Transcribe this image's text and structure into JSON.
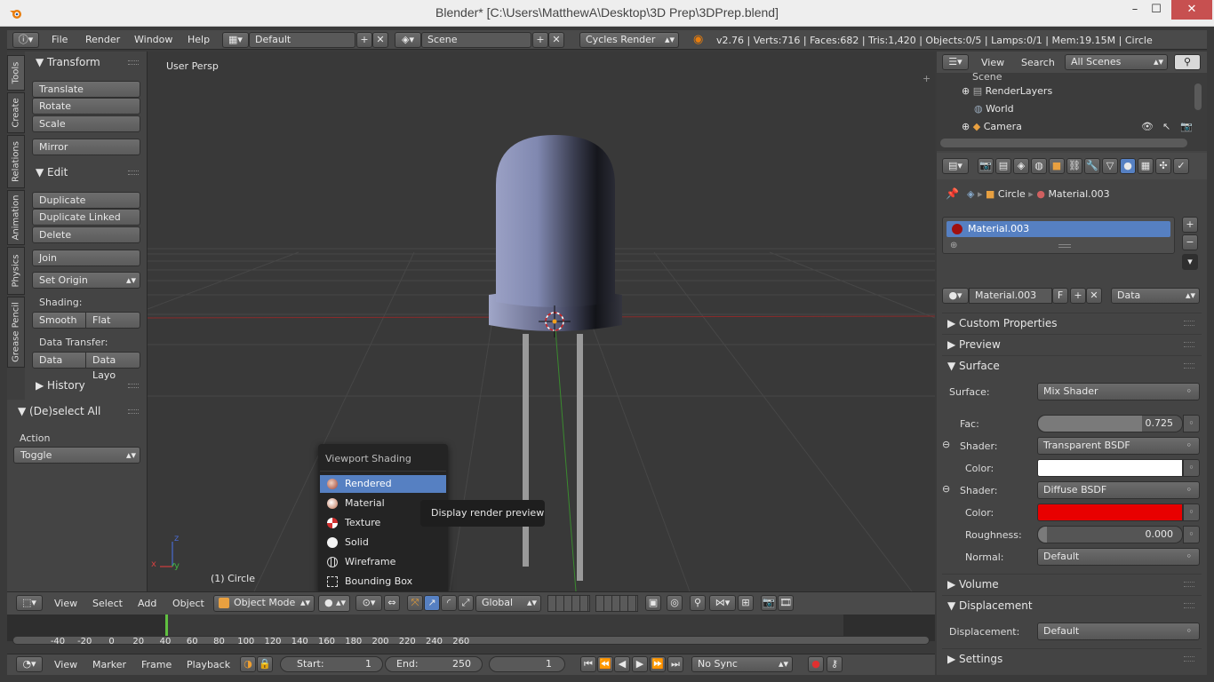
{
  "window": {
    "title": "Blender* [C:\\Users\\MatthewA\\Desktop\\3D Prep\\3DPrep.blend]",
    "minimize": "–",
    "maximize": "☐",
    "close": "✕"
  },
  "info_header": {
    "menus": [
      "File",
      "Render",
      "Window",
      "Help"
    ],
    "layout": "Default",
    "scene": "Scene",
    "engine": "Cycles Render",
    "stats": "v2.76 | Verts:716 | Faces:682 | Tris:1,420 | Objects:0/5 | Lamps:0/1 | Mem:19.15M | Circle"
  },
  "left_tabs": [
    "Tools",
    "Create",
    "Relations",
    "Animation",
    "Physics",
    "Grease Pencil"
  ],
  "tool_shelf": {
    "transform_title": "Transform",
    "translate": "Translate",
    "rotate": "Rotate",
    "scale": "Scale",
    "mirror": "Mirror",
    "edit_title": "Edit",
    "duplicate": "Duplicate",
    "duplicate_linked": "Duplicate Linked",
    "delete": "Delete",
    "join": "Join",
    "set_origin": "Set Origin",
    "shading_label": "Shading:",
    "smooth": "Smooth",
    "flat": "Flat",
    "data_transfer_label": "Data Transfer:",
    "data": "Data",
    "data_layout": "Data Layo",
    "history_title": "History"
  },
  "operator_panel": {
    "title": "(De)select All",
    "action_label": "Action",
    "action_value": "Toggle"
  },
  "viewport": {
    "view_label": "User Persp",
    "object_label": "(1) Circle",
    "axis_x": "x",
    "axis_y": "y",
    "axis_z": "z"
  },
  "shading_popup": {
    "title": "Viewport Shading",
    "items": [
      "Rendered",
      "Material",
      "Texture",
      "Solid",
      "Wireframe",
      "Bounding Box"
    ],
    "selected": "Rendered"
  },
  "tooltip": "Display render preview",
  "viewport_header": {
    "menus": [
      "View",
      "Select",
      "Add",
      "Object"
    ],
    "mode": "Object Mode",
    "orientation": "Global"
  },
  "timeline": {
    "ticks": [
      "-40",
      "-20",
      "0",
      "20",
      "40",
      "60",
      "80",
      "100",
      "120",
      "140",
      "160",
      "180",
      "200",
      "220",
      "240",
      "260"
    ],
    "current_frame_mark": 0
  },
  "timeline_header": {
    "menus": [
      "View",
      "Marker",
      "Frame",
      "Playback"
    ],
    "start_label": "Start:",
    "start_value": "1",
    "end_label": "End:",
    "end_value": "250",
    "current_frame": "1",
    "sync": "No Sync"
  },
  "outliner": {
    "menus": [
      "View",
      "Search"
    ],
    "filter": "All Scenes",
    "items": [
      "Scene",
      "RenderLayers",
      "World",
      "Camera"
    ]
  },
  "properties": {
    "breadcrumb_object": "Circle",
    "breadcrumb_material": "Material.003",
    "slot_name": "Material.003",
    "material_field": "Material.003",
    "fake_user": "F",
    "link": "Data",
    "sections": {
      "custom_properties": "Custom Properties",
      "preview": "Preview",
      "surface": "Surface",
      "volume": "Volume",
      "displacement": "Displacement",
      "settings": "Settings"
    },
    "surface_label": "Surface:",
    "surface_value": "Mix Shader",
    "fac_label": "Fac:",
    "fac_value": "0.725",
    "fac": 0.725,
    "shader1_label": "Shader:",
    "shader1_value": "Transparent BSDF",
    "color1_label": "Color:",
    "color1": "#ffffff",
    "shader2_label": "Shader:",
    "shader2_value": "Diffuse BSDF",
    "color2_label": "Color:",
    "color2": "#e80000",
    "roughness_label": "Roughness:",
    "roughness_value": "0.000",
    "normal_label": "Normal:",
    "normal_value": "Default",
    "displacement_label": "Displacement:",
    "displacement_value": "Default"
  },
  "colors": {
    "accent": "#5680c2",
    "title_bg": "#eeeeee",
    "close_red": "#c75050"
  }
}
